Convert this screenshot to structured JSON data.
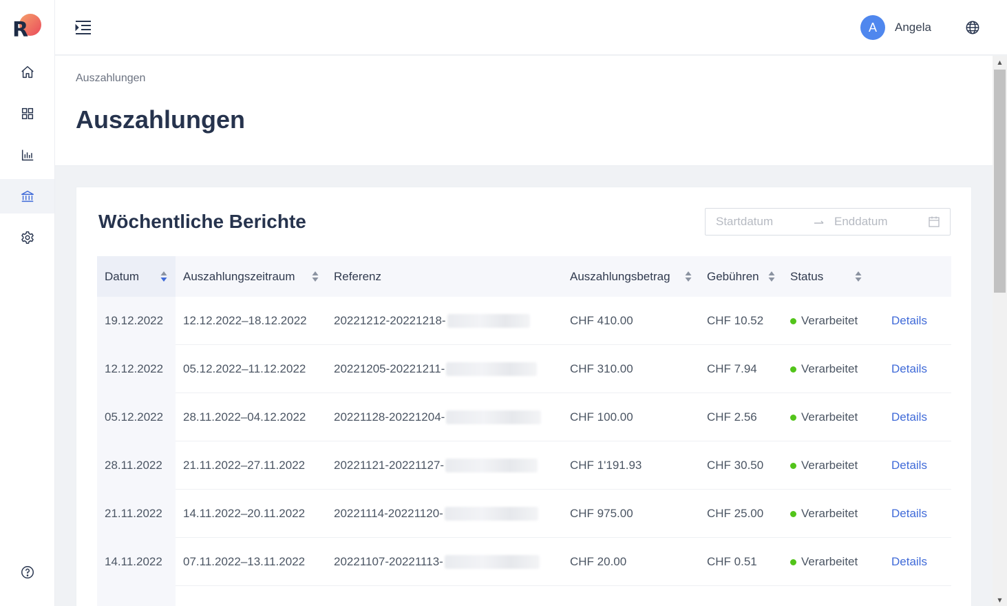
{
  "brand": {
    "logo_letter": "R"
  },
  "sidebar": {
    "items": [
      {
        "name": "home",
        "icon": "home-icon",
        "active": false
      },
      {
        "name": "dashboard",
        "icon": "grid-icon",
        "active": false
      },
      {
        "name": "reports",
        "icon": "bar-chart-icon",
        "active": false
      },
      {
        "name": "payouts",
        "icon": "bank-icon",
        "active": true
      },
      {
        "name": "settings",
        "icon": "gear-icon",
        "active": false
      }
    ],
    "help_icon": "help-circle-icon"
  },
  "header": {
    "menu_icon": "indent-icon",
    "user": {
      "avatar_initial": "A",
      "name": "Angela"
    },
    "language_icon": "globe-icon"
  },
  "page": {
    "breadcrumb": "Auszahlungen",
    "title": "Auszahlungen"
  },
  "card": {
    "title": "Wöchentliche Berichte",
    "date_range": {
      "start_placeholder": "Startdatum",
      "end_placeholder": "Enddatum"
    }
  },
  "table": {
    "columns": [
      "Datum",
      "Auszahlungszeitraum",
      "Referenz",
      "Auszahlungsbetrag",
      "Gebühren",
      "Status"
    ],
    "rows": [
      {
        "date": "19.12.2022",
        "period": "12.12.2022–18.12.2022",
        "ref": "20221212-20221218-",
        "amount": "CHF 410.00",
        "fee": "CHF 10.52",
        "status": "Verarbeitet",
        "action": "Details"
      },
      {
        "date": "12.12.2022",
        "period": "05.12.2022–11.12.2022",
        "ref": "20221205-20221211-",
        "amount": "CHF 310.00",
        "fee": "CHF 7.94",
        "status": "Verarbeitet",
        "action": "Details"
      },
      {
        "date": "05.12.2022",
        "period": "28.11.2022–04.12.2022",
        "ref": "20221128-20221204-",
        "amount": "CHF 100.00",
        "fee": "CHF 2.56",
        "status": "Verarbeitet",
        "action": "Details"
      },
      {
        "date": "28.11.2022",
        "period": "21.11.2022–27.11.2022",
        "ref": "20221121-20221127-",
        "amount": "CHF 1'191.93",
        "fee": "CHF 30.50",
        "status": "Verarbeitet",
        "action": "Details"
      },
      {
        "date": "21.11.2022",
        "period": "14.11.2022–20.11.2022",
        "ref": "20221114-20221120-",
        "amount": "CHF 975.00",
        "fee": "CHF 25.00",
        "status": "Verarbeitet",
        "action": "Details"
      },
      {
        "date": "14.11.2022",
        "period": "07.11.2022–13.11.2022",
        "ref": "20221107-20221113-",
        "amount": "CHF 20.00",
        "fee": "CHF 0.51",
        "status": "Verarbeitet",
        "action": "Details"
      }
    ]
  },
  "colors": {
    "accent": "#3f6ad8",
    "status_ok": "#52c41a",
    "title": "#26334d"
  }
}
